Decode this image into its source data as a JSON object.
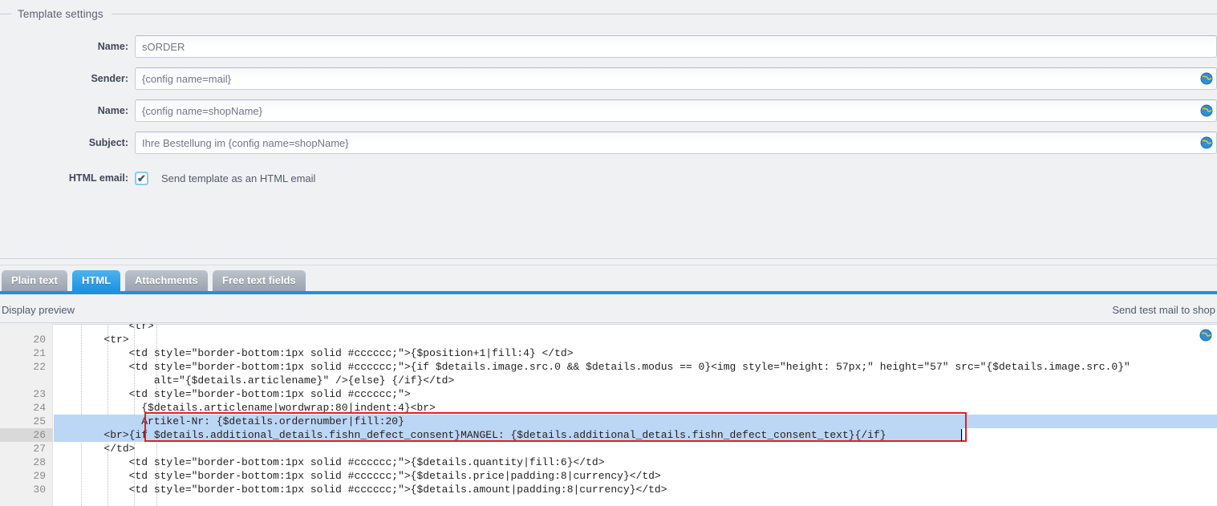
{
  "panel": {
    "legend": "Template settings"
  },
  "form": {
    "rows": [
      {
        "label": "Name:",
        "value": "sORDER",
        "placeholder": "",
        "icon": "globe-icon",
        "has_icon": false
      },
      {
        "label": "Sender:",
        "value": "{config name=mail}",
        "placeholder": "",
        "icon": "globe-icon",
        "has_icon": true
      },
      {
        "label": "Name:",
        "value": "{config name=shopName}",
        "placeholder": "",
        "icon": "globe-icon",
        "has_icon": true
      },
      {
        "label": "Subject:",
        "value": "Ihre Bestellung im {config name=shopName}",
        "placeholder": "",
        "icon": "globe-icon",
        "has_icon": true
      }
    ],
    "checkbox": {
      "label": "HTML email:",
      "text": "Send template as an HTML email",
      "checked": true,
      "check_glyph": "✔"
    }
  },
  "tabs": {
    "items": [
      {
        "label": "Plain text",
        "active": false
      },
      {
        "label": "HTML",
        "active": true
      },
      {
        "label": "Attachments",
        "active": false
      },
      {
        "label": "Free text fields",
        "active": false
      }
    ],
    "accent_color": "#1b92e2",
    "inactive_color": "#9ba3ae"
  },
  "preview_bar": {
    "left_label": "Display preview",
    "right_label": "Send test mail to shop"
  },
  "editor": {
    "active_line": 26,
    "selected_lines": [
      25,
      26
    ],
    "highlight_color": "#bcd6f5",
    "marker_color": "#e02020",
    "globe_icon": "globe-icon",
    "partial_top_line": "            <tr>",
    "lines": [
      {
        "num": 20,
        "text": "        <tr>"
      },
      {
        "num": 21,
        "text": "            <td style=\"border-bottom:1px solid #cccccc;\">{$position+1|fill:4} </td>"
      },
      {
        "num": 22,
        "text": "            <td style=\"border-bottom:1px solid #cccccc;\">{if $details.image.src.0 && $details.modus == 0}<img style=\"height: 57px;\" height=\"57\" src=\"{$details.image.src.0}\""
      },
      {
        "num": null,
        "text": "                alt=\"{$details.articlename}\" />{else} {/if}</td>"
      },
      {
        "num": 23,
        "text": "            <td style=\"border-bottom:1px solid #cccccc;\">"
      },
      {
        "num": 24,
        "text": "              {$details.articlename|wordwrap:80|indent:4}<br>"
      },
      {
        "num": 25,
        "text": "              Artikel-Nr: {$details.ordernumber|fill:20}"
      },
      {
        "num": 26,
        "text": "        <br>{if $details.additional_details.fishn_defect_consent}MANGEL: {$details.additional_details.fishn_defect_consent_text}{/if}"
      },
      {
        "num": 27,
        "text": "        </td>"
      },
      {
        "num": 28,
        "text": "            <td style=\"border-bottom:1px solid #cccccc;\">{$details.quantity|fill:6}</td>"
      },
      {
        "num": 29,
        "text": "            <td style=\"border-bottom:1px solid #cccccc;\">{$details.price|padding:8|currency}</td>"
      },
      {
        "num": 30,
        "text": "            <td style=\"border-bottom:1px solid #cccccc;\">{$details.amount|padding:8|currency}</td>"
      }
    ]
  }
}
